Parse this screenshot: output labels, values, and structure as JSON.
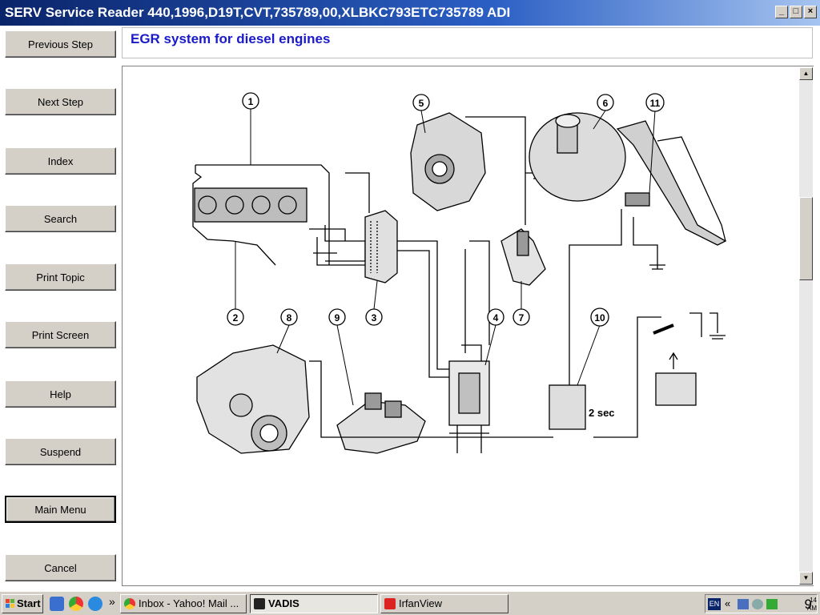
{
  "window": {
    "title": "SERV Service Reader 440,1996,D19T,CVT,735789,00,XLBKC793ETC735789 ADI",
    "controls": [
      "_",
      "□",
      "×"
    ]
  },
  "sidebar": {
    "buttons": [
      {
        "label": "Previous Step"
      },
      {
        "label": "Next Step"
      },
      {
        "label": "Index"
      },
      {
        "label": "Search"
      },
      {
        "label": "Print Topic"
      },
      {
        "label": "Print Screen"
      },
      {
        "label": "Help"
      },
      {
        "label": "Suspend"
      },
      {
        "label": "Main Menu"
      },
      {
        "label": "Cancel"
      }
    ]
  },
  "topic": {
    "title": "EGR system for diesel engines"
  },
  "diagram": {
    "callouts": [
      "1",
      "2",
      "3",
      "4",
      "5",
      "6",
      "7",
      "8",
      "9",
      "10",
      "11"
    ],
    "timer_label": "2 sec"
  },
  "taskbar": {
    "start_label": "Start",
    "chevron": "»",
    "items": [
      {
        "label": "Inbox - Yahoo! Mail ...",
        "icon": "chrome-icon"
      },
      {
        "label": "VADIS",
        "icon": "vadis-icon"
      },
      {
        "label": "IrfanView",
        "icon": "irfanview-icon"
      }
    ],
    "tray": {
      "lang": "EN",
      "chevron": "«",
      "time": "9",
      "minutes": "14",
      "ampm": "AM"
    }
  }
}
